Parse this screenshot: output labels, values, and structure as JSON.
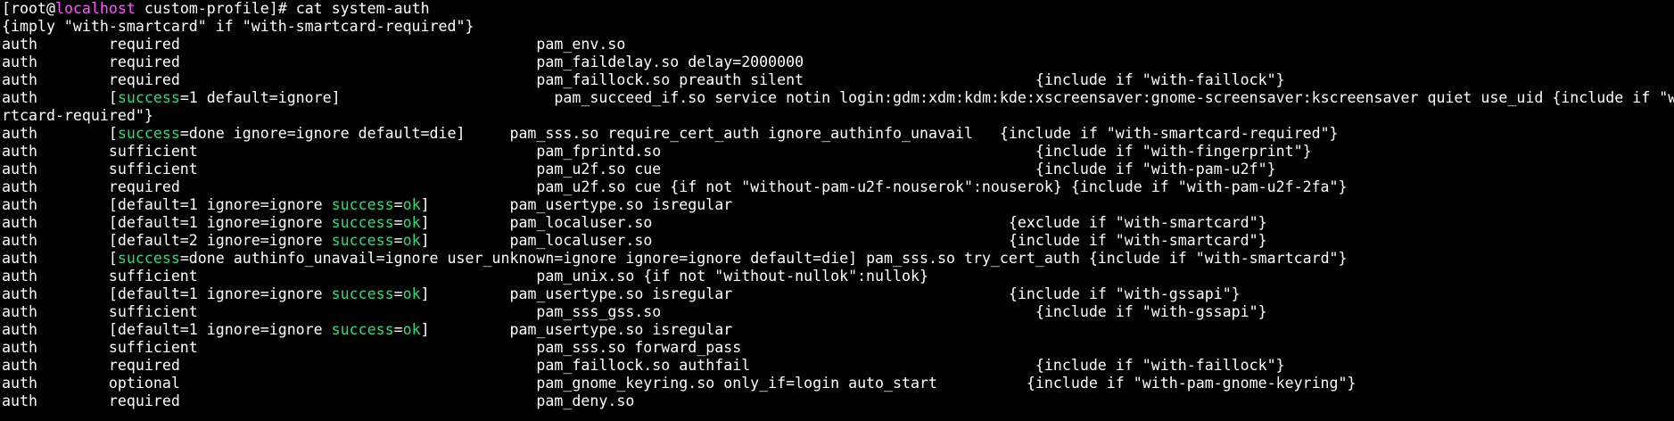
{
  "terminal": {
    "prompt": {
      "user": "root",
      "at": "@",
      "host": "localhost",
      "cwd": "custom-profile",
      "command": "cat system-auth"
    },
    "lines": [
      [
        {
          "t": "[root@"
        },
        {
          "t": "localhost",
          "c": "magenta"
        },
        {
          "t": " custom-profile]# cat system-auth"
        }
      ],
      [
        {
          "t": "{imply \"with-smartcard\" if \"with-smartcard-required\"}"
        }
      ],
      [
        {
          "t": "auth        required                                        pam_env.so"
        }
      ],
      [
        {
          "t": "auth        required                                        pam_faildelay.so delay=2000000"
        }
      ],
      [
        {
          "t": "auth        required                                        pam_faillock.so preauth silent                          {include if \"with-faillock\"}"
        }
      ],
      [
        {
          "t": "auth        ["
        },
        {
          "t": "success",
          "c": "green"
        },
        {
          "t": "=1 default=ignore]                        pam_succeed_if.so service notin login:gdm:xdm:kdm:kde:xscreensaver:gnome-screensaver:kscreensaver quiet use_uid {include if \"with-sma"
        }
      ],
      [
        {
          "t": "rtcard-required\"}"
        }
      ],
      [
        {
          "t": "auth        ["
        },
        {
          "t": "success",
          "c": "green"
        },
        {
          "t": "=done ignore=ignore default=die]     pam_sss.so require_cert_auth ignore_authinfo_unavail   {include if \"with-smartcard-required\"}"
        }
      ],
      [
        {
          "t": "auth        sufficient                                      pam_fprintd.so                                          {include if \"with-fingerprint\"}"
        }
      ],
      [
        {
          "t": "auth        sufficient                                      pam_u2f.so cue                                          {include if \"with-pam-u2f\"}"
        }
      ],
      [
        {
          "t": "auth        required                                        pam_u2f.so cue {if not \"without-pam-u2f-nouserok\":nouserok} {include if \"with-pam-u2f-2fa\"}"
        }
      ],
      [
        {
          "t": "auth        [default=1 ignore=ignore "
        },
        {
          "t": "success",
          "c": "green"
        },
        {
          "t": "="
        },
        {
          "t": "ok",
          "c": "green"
        },
        {
          "t": "]         pam_usertype.so isregular"
        }
      ],
      [
        {
          "t": "auth        [default=1 ignore=ignore "
        },
        {
          "t": "success",
          "c": "green"
        },
        {
          "t": "="
        },
        {
          "t": "ok",
          "c": "green"
        },
        {
          "t": "]         pam_localuser.so                                        {exclude if \"with-smartcard\"}"
        }
      ],
      [
        {
          "t": "auth        [default=2 ignore=ignore "
        },
        {
          "t": "success",
          "c": "green"
        },
        {
          "t": "="
        },
        {
          "t": "ok",
          "c": "green"
        },
        {
          "t": "]         pam_localuser.so                                        {include if \"with-smartcard\"}"
        }
      ],
      [
        {
          "t": "auth        ["
        },
        {
          "t": "success",
          "c": "green"
        },
        {
          "t": "=done authinfo_unavail=ignore user_unknown=ignore ignore=ignore default=die] pam_sss.so try_cert_auth {include if \"with-smartcard\"}"
        }
      ],
      [
        {
          "t": "auth        sufficient                                      pam_unix.so {if not \"without-nullok\":nullok}"
        }
      ],
      [
        {
          "t": "auth        [default=1 ignore=ignore "
        },
        {
          "t": "success",
          "c": "green"
        },
        {
          "t": "="
        },
        {
          "t": "ok",
          "c": "green"
        },
        {
          "t": "]         pam_usertype.so isregular                               {include if \"with-gssapi\"}"
        }
      ],
      [
        {
          "t": "auth        sufficient                                      pam_sss_gss.so                                          {include if \"with-gssapi\"}"
        }
      ],
      [
        {
          "t": "auth        [default=1 ignore=ignore "
        },
        {
          "t": "success",
          "c": "green"
        },
        {
          "t": "="
        },
        {
          "t": "ok",
          "c": "green"
        },
        {
          "t": "]         pam_usertype.so isregular"
        }
      ],
      [
        {
          "t": "auth        sufficient                                      pam_sss.so forward_pass"
        }
      ],
      [
        {
          "t": "auth        required                                        pam_faillock.so authfail                                {include if \"with-faillock\"}"
        }
      ],
      [
        {
          "t": "auth        optional                                        pam_gnome_keyring.so only_if=login auto_start          {include if \"with-pam-gnome-keyring\"}"
        }
      ],
      [
        {
          "t": "auth        required                                        pam_deny.so"
        }
      ]
    ]
  }
}
